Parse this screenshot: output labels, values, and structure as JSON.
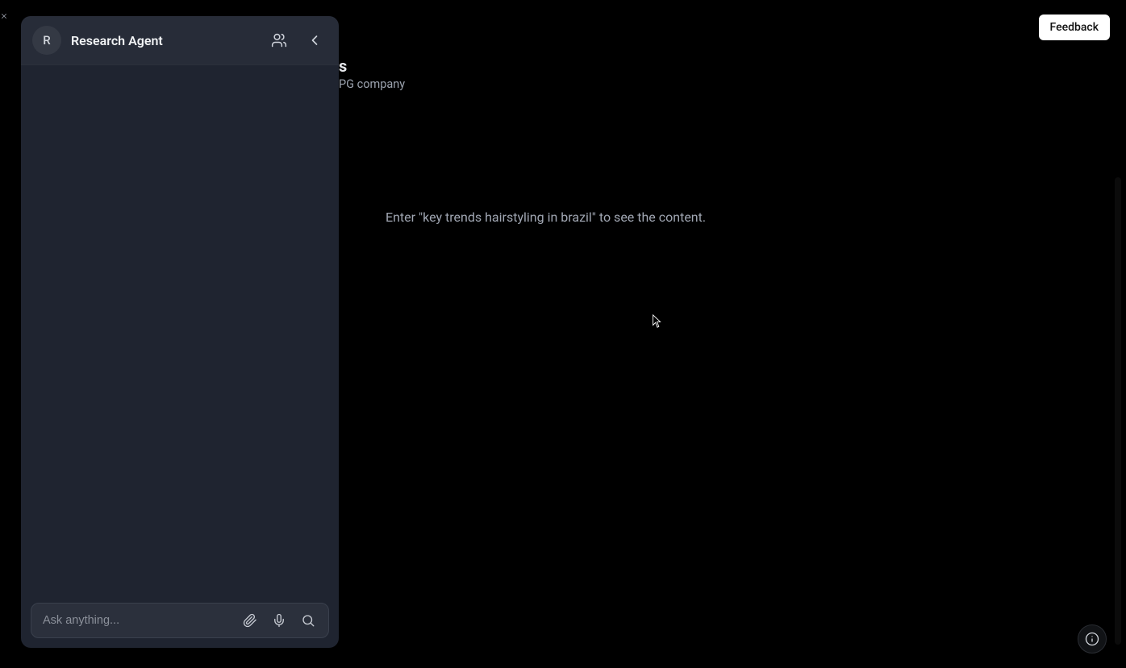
{
  "sidebar": {
    "avatar_initial": "R",
    "title": "Research Agent",
    "input_placeholder": "Ask anything..."
  },
  "header": {
    "feedback_label": "Feedback"
  },
  "background": {
    "title_fragment": "s",
    "subtitle_fragment": "PG company"
  },
  "main": {
    "placeholder_text": "Enter \"key trends hairstyling in brazil\" to see the content."
  }
}
